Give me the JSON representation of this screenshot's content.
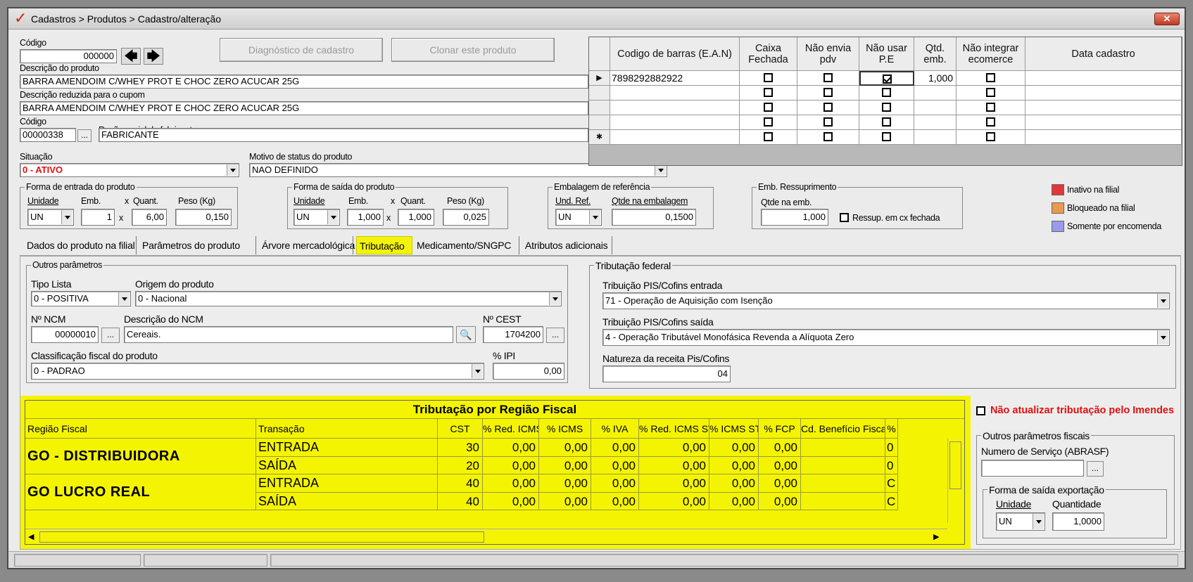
{
  "window": {
    "breadcrumb": "Cadastros > Produtos > Cadastro/alteração",
    "close_label": "✕"
  },
  "product": {
    "codigo_label": "Código",
    "codigo_value": "000000",
    "descricao_label": "Descrição  do produto",
    "descricao_value": "BARRA AMENDOIM C/WHEY PROT E CHOC ZERO ACUCAR 25G",
    "desc_reduzida_label": "Descrição reduzida para o cupom",
    "desc_reduzida_value": "BARRA AMENDOIM C/WHEY PROT E CHOC ZERO ACUCAR 25G",
    "fab_codigo_label": "Código",
    "fab_codigo_value": "00000338",
    "fab_razao_label": "Razão social do fabricante",
    "fab_razao_value": "FABRICANTE",
    "situacao_label": "Situação",
    "situacao_value": "0 - ATIVO",
    "motivo_label": "Motivo de status do produto",
    "motivo_value": "NAO DEFINIDO",
    "diag_button": "Diagnóstico de cadastro",
    "clonar_button": "Clonar este produto",
    "ellipsis": "..."
  },
  "forma_entrada": {
    "title": "Forma de entrada do produto",
    "unidade_label": "Unidade",
    "emb_label": "Emb.",
    "x": "x",
    "quant_label": "Quant.",
    "peso_label": "Peso (Kg)",
    "unidade": "UN",
    "emb": "1",
    "quant": "6,00",
    "peso": "0,150"
  },
  "forma_saida": {
    "title": "Forma de saída do produto",
    "unidade_label": "Unidade",
    "emb_label": "Emb.",
    "x": "x",
    "quant_label": "Quant.",
    "peso_label": "Peso (Kg)",
    "unidade": "UN",
    "emb": "1,000",
    "quant": "1,000",
    "peso": "0,025"
  },
  "embalagem_ref": {
    "title": "Embalagem de referência",
    "und_label": "Und. Ref.",
    "qtde_label": "Qtde na embalagem",
    "und": "UN",
    "qtde": "0,1500"
  },
  "emb_ressup": {
    "title": "Emb. Ressuprimento",
    "qtde_label": "Qtde na emb.",
    "qtde": "1,000",
    "check_label": "Ressup. em cx fechada"
  },
  "legend": [
    {
      "label": "Inativo na filial",
      "color": "#e03838"
    },
    {
      "label": "Bloqueado na filial",
      "color": "#e89a50"
    },
    {
      "label": "Somente por encomenda",
      "color": "#9a9ae8"
    }
  ],
  "barcode_grid": {
    "headers": [
      "Codigo de barras (E.A.N)",
      "Caixa\nFechada",
      "Não envia\npdv",
      "Não usar\nP.E",
      "Qtd.\nemb.",
      "Não integrar\necomerce",
      "Data cadastro"
    ],
    "rows": [
      {
        "indicator": "▶",
        "code": "7898292882922",
        "caixa": false,
        "nao_envia": false,
        "nao_usar": true,
        "qtd": "1,000",
        "nao_integrar": false,
        "data": ""
      },
      {
        "indicator": "",
        "code": "",
        "caixa": false,
        "nao_envia": false,
        "nao_usar": false,
        "qtd": "",
        "nao_integrar": false,
        "data": ""
      },
      {
        "indicator": "",
        "code": "",
        "caixa": false,
        "nao_envia": false,
        "nao_usar": false,
        "qtd": "",
        "nao_integrar": false,
        "data": ""
      },
      {
        "indicator": "",
        "code": "",
        "caixa": false,
        "nao_envia": false,
        "nao_usar": false,
        "qtd": "",
        "nao_integrar": false,
        "data": ""
      },
      {
        "indicator": "✱",
        "code": "",
        "caixa": false,
        "nao_envia": false,
        "nao_usar": false,
        "qtd": "",
        "nao_integrar": false,
        "data": ""
      }
    ]
  },
  "tabs": [
    {
      "label": "Dados do produto na filial",
      "active": false
    },
    {
      "label": "Parâmetros do produto",
      "active": false
    },
    {
      "label": "Árvore mercadológica",
      "active": false
    },
    {
      "label": "Tributação",
      "active": true
    },
    {
      "label": "Medicamento/SNGPC",
      "active": false
    },
    {
      "label": "Atributos adicionais",
      "active": false
    }
  ],
  "outros_param": {
    "title": "Outros parâmetros",
    "tipo_lista_label": "Tipo Lista",
    "tipo_lista": "0 - POSITIVA",
    "origem_label": "Origem do produto",
    "origem": "0 - Nacional",
    "ncm_label": "Nº NCM",
    "ncm": "00000010",
    "desc_ncm_label": "Descrição do NCM",
    "desc_ncm": "Cereais.",
    "cest_label": "Nº CEST",
    "cest": "1704200",
    "classif_label": "Classificação fiscal do produto",
    "classif": "0 - PADRAO",
    "ipi_label": "% IPI",
    "ipi": "0,00"
  },
  "trib_federal": {
    "title": "Tributação federal",
    "entrada_label": "Tribuição PIS/Cofins entrada",
    "entrada": "71 -  Operação de Aquisição com Isenção",
    "saida_label": "Tribuição PIS/Cofins saída",
    "saida": "4 -  Operação Tributável Monofásica Revenda a Alíquota Zero",
    "natureza_label": "Natureza da receita Pis/Cofins",
    "natureza": "04"
  },
  "regiao": {
    "title": "Tributação por Região Fiscal",
    "headers": [
      "Região Fiscal",
      "Transação",
      "CST",
      "% Red. ICMS",
      "% ICMS",
      "% IVA",
      "% Red. ICMS ST",
      "% ICMS ST",
      "% FCP",
      "Cd. Benefício Fiscal",
      "%"
    ],
    "groups": [
      {
        "name": "GO - DISTRIBUIDORA",
        "rows": [
          {
            "transacao": "ENTRADA",
            "cst": "30",
            "red_icms": "0,00",
            "icms": "0,00",
            "iva": "0,00",
            "red_icms_st": "0,00",
            "icms_st": "0,00",
            "fcp": "0,00",
            "cd": "",
            "extra": "0"
          },
          {
            "transacao": "SAÍDA",
            "cst": "20",
            "red_icms": "0,00",
            "icms": "0,00",
            "iva": "0,00",
            "red_icms_st": "0,00",
            "icms_st": "0,00",
            "fcp": "0,00",
            "cd": "",
            "extra": "0"
          }
        ]
      },
      {
        "name": "GO LUCRO REAL",
        "rows": [
          {
            "transacao": "ENTRADA",
            "cst": "40",
            "red_icms": "0,00",
            "icms": "0,00",
            "iva": "0,00",
            "red_icms_st": "0,00",
            "icms_st": "0,00",
            "fcp": "0,00",
            "cd": "",
            "extra": "C"
          },
          {
            "transacao": "SAÍDA",
            "cst": "40",
            "red_icms": "0,00",
            "icms": "0,00",
            "iva": "0,00",
            "red_icms_st": "0,00",
            "icms_st": "0,00",
            "fcp": "0,00",
            "cd": "",
            "extra": "C"
          }
        ]
      }
    ]
  },
  "nao_atualizar_label": "Não atualizar tributação pelo Imendes",
  "outros_fiscais": {
    "title": "Outros parâmetros fiscais",
    "servico_label": "Numero de Serviço (ABRASF)",
    "servico": "",
    "forma_exp_title": "Forma de saída exportação",
    "unidade_label": "Unidade",
    "quantidade_label": "Quantidade",
    "unidade": "UN",
    "quantidade": "1,0000"
  }
}
